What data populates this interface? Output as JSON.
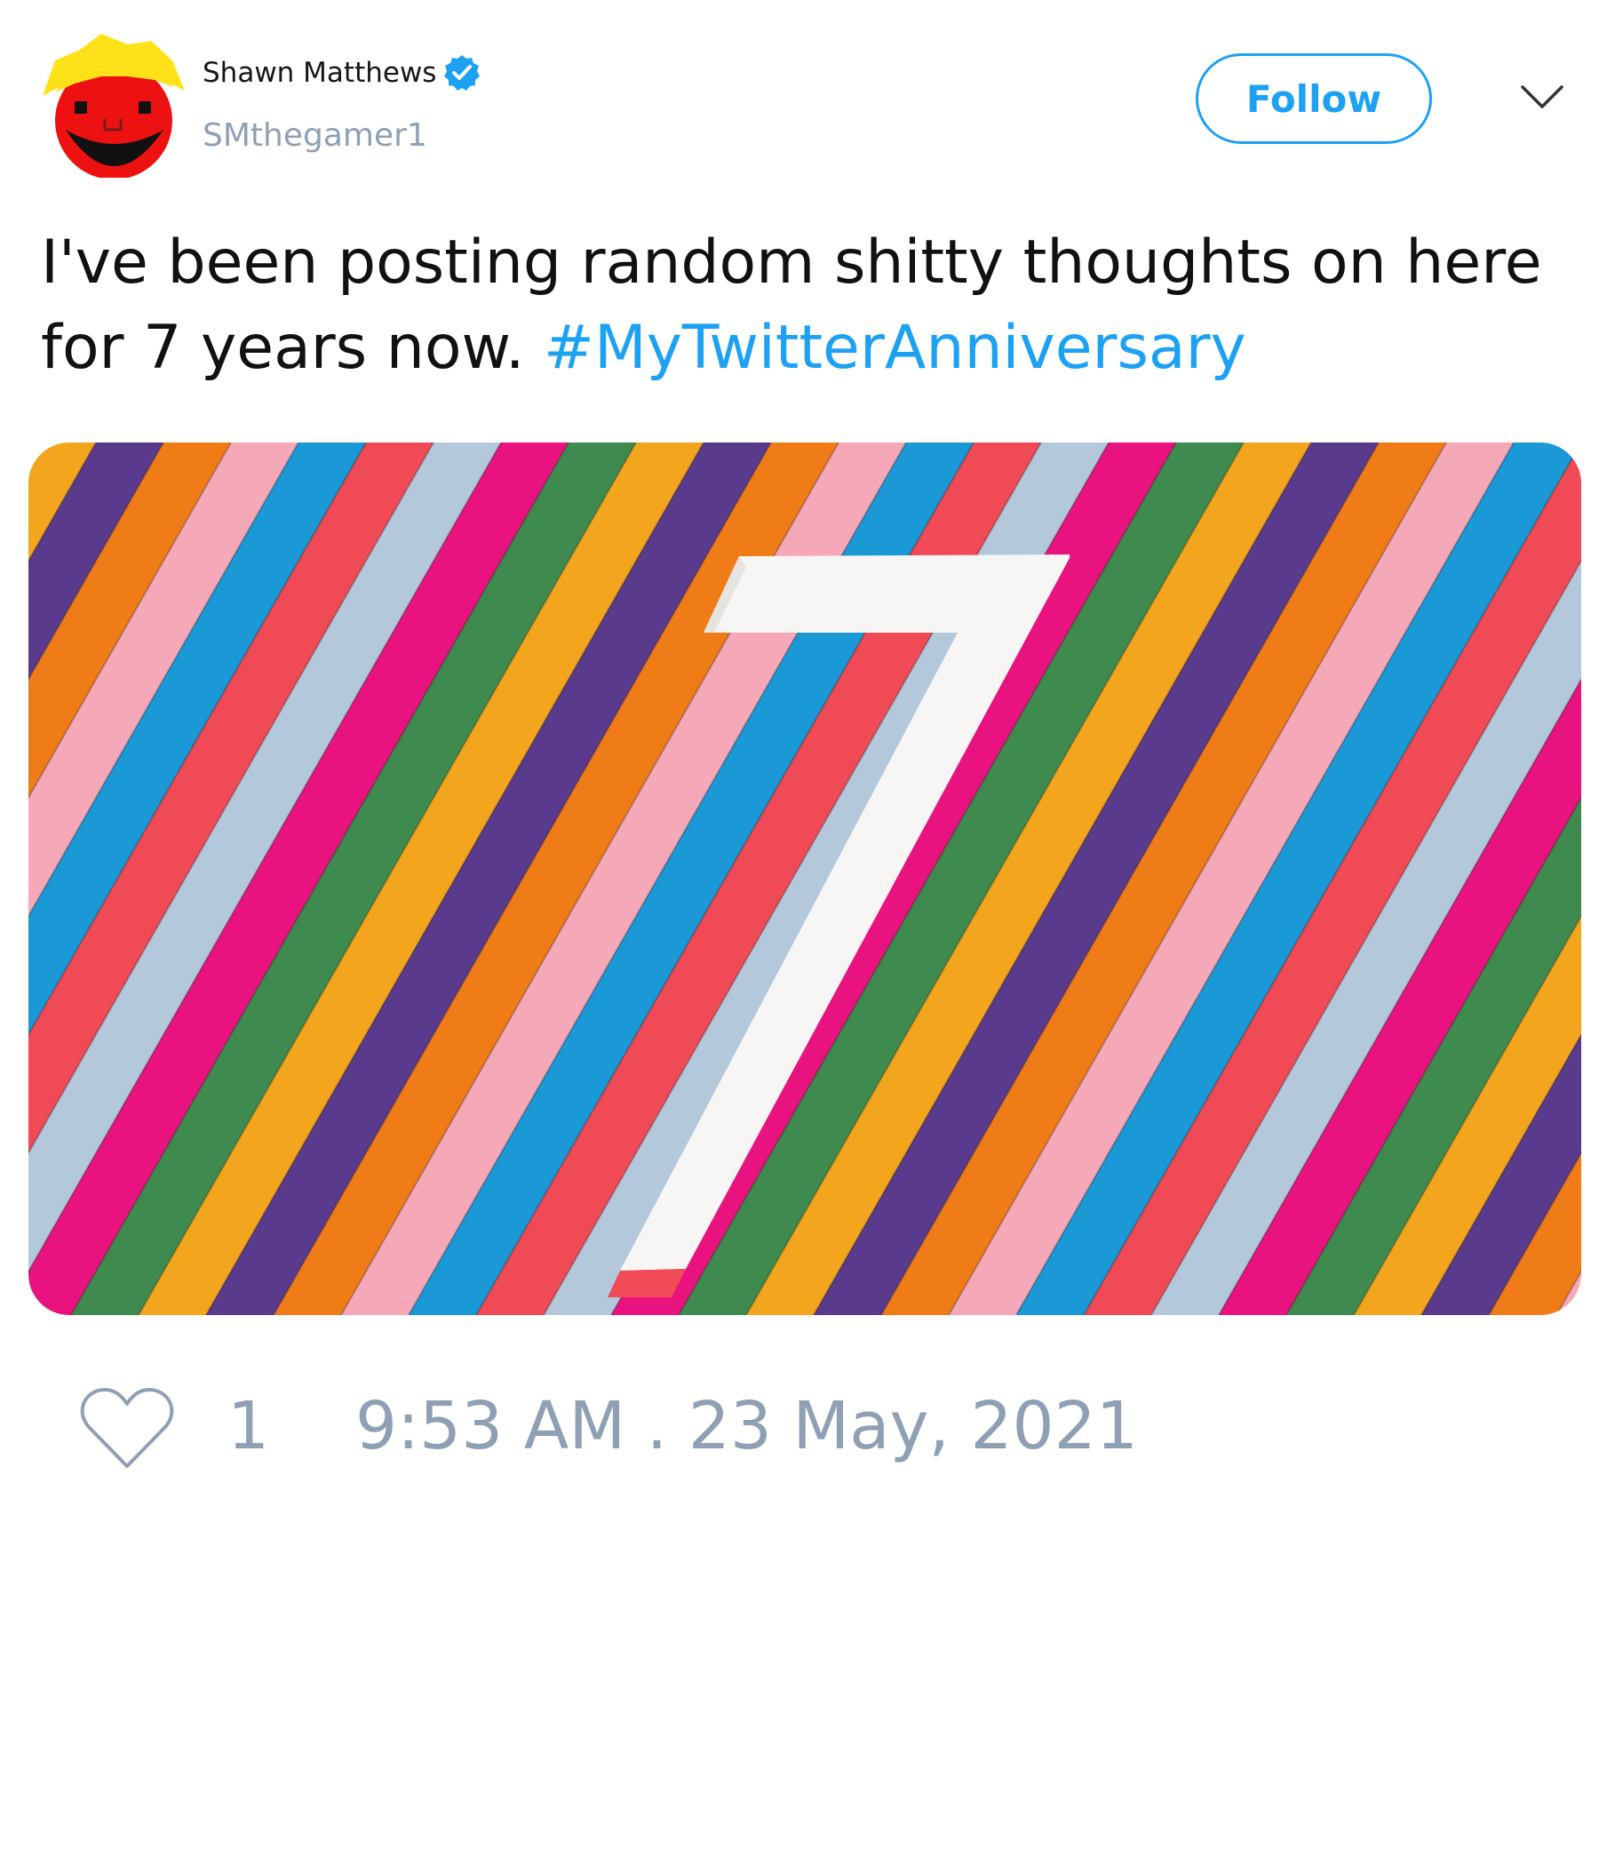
{
  "author": {
    "display_name": "Shawn Matthews",
    "handle": "SMthegamer1",
    "verified": true,
    "avatar_icon": "red-smiley-face-yellow-hair-avatar"
  },
  "follow_label": "Follow",
  "menu_icon": "chevron-down-icon",
  "tweet": {
    "text": "I've been posting random shitty thoughts on here for 7 years now. ",
    "hashtag": "#MyTwitterAnniversary"
  },
  "media": {
    "description_icon": "rainbow-stripes-number-seven-image",
    "stripe_colors": [
      "#3f8a4f",
      "#f2a51d",
      "#5a3a8c",
      "#f07c18",
      "#f5a8b8",
      "#1a99d6",
      "#ef4a55",
      "#b4c8dc",
      "#e8137f"
    ]
  },
  "footer": {
    "like_count": "1",
    "timestamp": "9:53 AM . 23 May, 2021"
  },
  "colors": {
    "accent": "#1da1f2",
    "muted": "#8fa0b4"
  }
}
